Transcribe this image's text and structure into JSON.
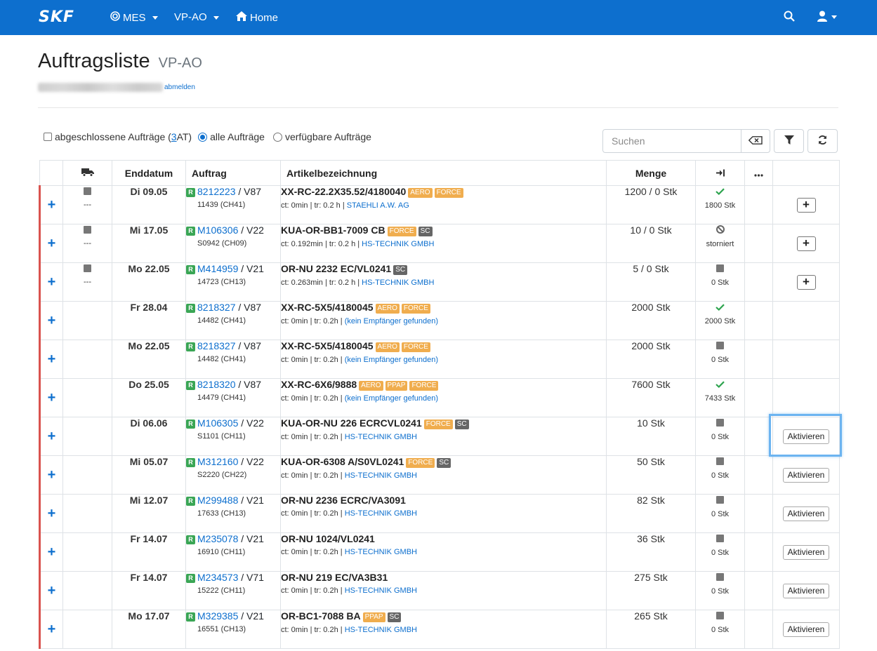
{
  "nav": {
    "brand": "SKF",
    "menu_mes": "MES",
    "menu_vpao": "VP-AO",
    "menu_home": "Home"
  },
  "header": {
    "title": "Auftragsliste",
    "subtitle": "VP-AO",
    "logout": "abmelden"
  },
  "filters": {
    "completed_label_pre": "abgeschlossene Aufträge (",
    "completed_count": "3",
    "completed_label_post": " AT)",
    "all_label": "alle Aufträge",
    "available_label": "verfügbare Aufträge"
  },
  "search": {
    "placeholder": "Suchen"
  },
  "table": {
    "headers": {
      "enddatum": "Enddatum",
      "auftrag": "Auftrag",
      "artikel": "Artikelbezeichnung",
      "menge": "Menge"
    },
    "rows": [
      {
        "truck_dash": "---",
        "date": "Di 09.05",
        "order": "8212223",
        "version": " / V87",
        "sub": "11439 (CH41)",
        "article": "XX-RC-22.2X35.52/4180040",
        "tags": [
          {
            "t": "AERO",
            "c": "orange"
          },
          {
            "t": "FORCE",
            "c": "orange"
          }
        ],
        "info": "ct: 0min | tr: 0.2 h | ",
        "receiver": "STAEHLI A.W. AG",
        "qty": "1200 / 0 Stk",
        "status": "check",
        "status_text": "1800 Stk",
        "action": "plus"
      },
      {
        "truck_dash": "---",
        "date": "Mi 17.05",
        "order": "M106306",
        "version": " / V22",
        "sub": "S0942 (CH09)",
        "article": "KUA-OR-BB1-7009 CB",
        "tags": [
          {
            "t": "FORCE",
            "c": "orange"
          },
          {
            "t": "SC",
            "c": "dark"
          }
        ],
        "info": "ct: 0.192min | tr: 0.2 h | ",
        "receiver": "HS-TECHNIK GMBH",
        "qty": "10 / 0 Stk",
        "status": "ban",
        "status_text": "storniert",
        "action": "plus"
      },
      {
        "truck_dash": "---",
        "date": "Mo 22.05",
        "order": "M414959",
        "version": " / V21",
        "sub": "14723 (CH13)",
        "article": "OR-NU 2232 EC/VL0241",
        "tags": [
          {
            "t": "SC",
            "c": "dark"
          }
        ],
        "info": "ct: 0.263min | tr: 0.2 h | ",
        "receiver": "HS-TECHNIK GMBH",
        "qty": "5 / 0 Stk",
        "status": "square",
        "status_text": "0 Stk",
        "action": "plus"
      },
      {
        "truck_dash": "",
        "date": "Fr 28.04",
        "order": "8218327",
        "version": " / V87",
        "sub": "14482 (CH41)",
        "article": "XX-RC-5X5/4180045",
        "tags": [
          {
            "t": "AERO",
            "c": "orange"
          },
          {
            "t": "FORCE",
            "c": "orange"
          }
        ],
        "info": "ct: 0min | tr: 0.2h | ",
        "receiver": "(kein Empfänger gefunden)",
        "qty": "2000 Stk",
        "status": "check",
        "status_text": "2000 Stk",
        "action": ""
      },
      {
        "truck_dash": "",
        "date": "Mo 22.05",
        "order": "8218327",
        "version": " / V87",
        "sub": "14482 (CH41)",
        "article": "XX-RC-5X5/4180045",
        "tags": [
          {
            "t": "AERO",
            "c": "orange"
          },
          {
            "t": "FORCE",
            "c": "orange"
          }
        ],
        "info": "ct: 0min | tr: 0.2h | ",
        "receiver": "(kein Empfänger gefunden)",
        "qty": "2000 Stk",
        "status": "square",
        "status_text": "0 Stk",
        "action": ""
      },
      {
        "truck_dash": "",
        "date": "Do 25.05",
        "order": "8218320",
        "version": " / V87",
        "sub": "14479 (CH41)",
        "article": "XX-RC-6X6/9888",
        "tags": [
          {
            "t": "AERO",
            "c": "orange"
          },
          {
            "t": "PPAP",
            "c": "orange"
          },
          {
            "t": "FORCE",
            "c": "orange"
          }
        ],
        "info": "ct: 0min | tr: 0.2h | ",
        "receiver": "(kein Empfänger gefunden)",
        "qty": "7600 Stk",
        "status": "check",
        "status_text": "7433 Stk",
        "action": ""
      },
      {
        "truck_dash": "",
        "date": "Di 06.06",
        "order": "M106305",
        "version": " / V22",
        "sub": "S1101 (CH11)",
        "article": "KUA-OR-NU 226 ECRCVL0241",
        "tags": [
          {
            "t": "FORCE",
            "c": "orange"
          },
          {
            "t": "SC",
            "c": "dark"
          }
        ],
        "info": "ct: 0min | tr: 0.2h | ",
        "receiver": "HS-TECHNIK GMBH",
        "qty": "10 Stk",
        "status": "square",
        "status_text": "0 Stk",
        "action": "activate"
      },
      {
        "truck_dash": "",
        "date": "Mi 05.07",
        "order": "M312160",
        "version": " / V22",
        "sub": "S2220 (CH22)",
        "article": "KUA-OR-6308 A/S0VL0241",
        "tags": [
          {
            "t": "FORCE",
            "c": "orange"
          },
          {
            "t": "SC",
            "c": "dark"
          }
        ],
        "info": "ct: 0min | tr: 0.2h | ",
        "receiver": "HS-TECHNIK GMBH",
        "qty": "50 Stk",
        "status": "square",
        "status_text": "0 Stk",
        "action": "activate"
      },
      {
        "truck_dash": "",
        "date": "Mi 12.07",
        "order": "M299488",
        "version": " / V21",
        "sub": "17633 (CH13)",
        "article": "OR-NU 2236 ECRC/VA3091",
        "tags": [],
        "info": "ct: 0min | tr: 0.2h | ",
        "receiver": "HS-TECHNIK GMBH",
        "qty": "82 Stk",
        "status": "square",
        "status_text": "0 Stk",
        "action": "activate"
      },
      {
        "truck_dash": "",
        "date": "Fr 14.07",
        "order": "M235078",
        "version": " / V21",
        "sub": "16910 (CH11)",
        "article": "OR-NU 1024/VL0241",
        "tags": [],
        "info": "ct: 0min | tr: 0.2h | ",
        "receiver": "HS-TECHNIK GMBH",
        "qty": "36 Stk",
        "status": "square",
        "status_text": "0 Stk",
        "action": "activate"
      },
      {
        "truck_dash": "",
        "date": "Fr 14.07",
        "order": "M234573",
        "version": " / V71",
        "sub": "15222 (CH11)",
        "article": "OR-NU 219 EC/VA3B31",
        "tags": [],
        "info": "ct: 0min | tr: 0.2h | ",
        "receiver": "HS-TECHNIK GMBH",
        "qty": "275 Stk",
        "status": "square",
        "status_text": "0 Stk",
        "action": "activate"
      },
      {
        "truck_dash": "",
        "date": "Mo 17.07",
        "order": "M329385",
        "version": " / V21",
        "sub": "16551 (CH13)",
        "article": "OR-BC1-7088 BA",
        "tags": [
          {
            "t": "PPAP",
            "c": "orange"
          },
          {
            "t": "SC",
            "c": "dark"
          }
        ],
        "info": "ct: 0min | tr: 0.2h | ",
        "receiver": "HS-TECHNIK GMBH",
        "qty": "265 Stk",
        "status": "square",
        "status_text": "0 Stk",
        "action": "activate"
      }
    ],
    "activate_label": "Aktivieren",
    "plus_label": "+",
    "expand_label": "+",
    "r_badge": "R"
  },
  "colors": {
    "navbar": "#0d6fce",
    "link": "#0d6fce",
    "row_marker": "#d9534f",
    "tag_orange": "#f0ad4e",
    "tag_dark": "#666666",
    "check_green": "#2ea44f"
  }
}
